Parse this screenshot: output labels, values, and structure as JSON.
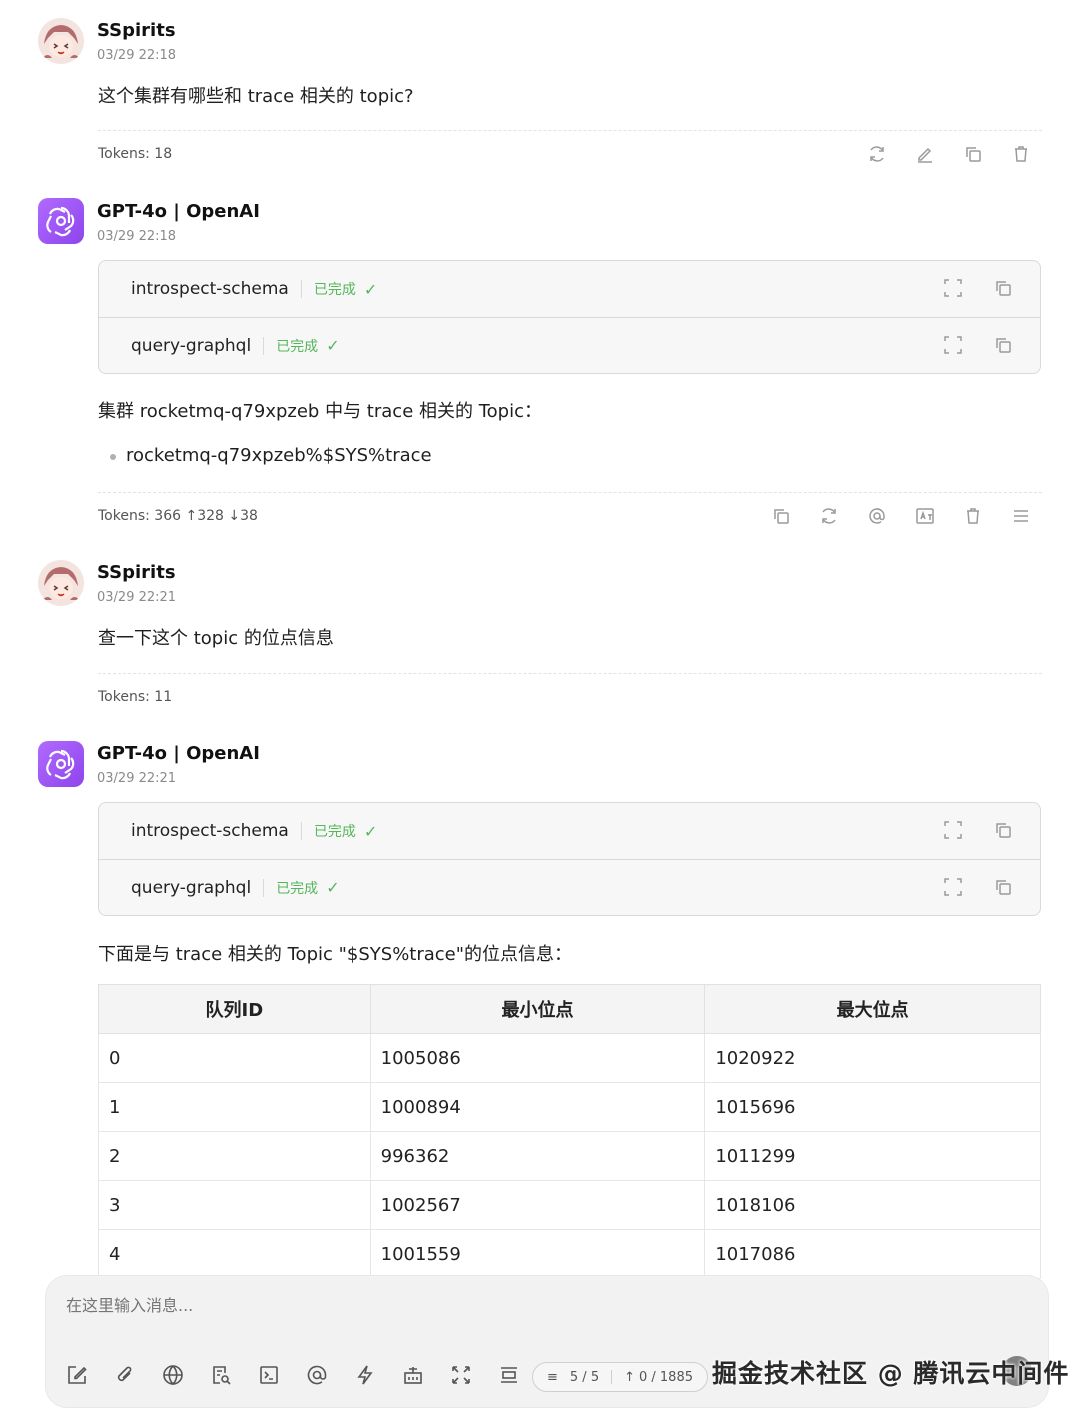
{
  "messages": [
    {
      "role": "user",
      "name": "SSpirits",
      "time": "03/29 22:18",
      "text": "这个集群有哪些和 trace 相关的 topic?",
      "tokens": "Tokens: 18"
    },
    {
      "role": "assistant",
      "name": "GPT-4o | OpenAI",
      "time": "03/29 22:18",
      "tools": [
        {
          "name": "introspect-schema",
          "status": "已完成"
        },
        {
          "name": "query-graphql",
          "status": "已完成"
        }
      ],
      "text": "集群 rocketmq-q79xpzeb 中与 trace 相关的 Topic：",
      "bullets": [
        "rocketmq-q79xpzeb%$SYS%trace"
      ],
      "tokens": "Tokens: 366 ↑328 ↓38"
    },
    {
      "role": "user",
      "name": "SSpirits",
      "time": "03/29 22:21",
      "text": "查一下这个 topic 的位点信息",
      "tokens": "Tokens: 11"
    },
    {
      "role": "assistant",
      "name": "GPT-4o | OpenAI",
      "time": "03/29 22:21",
      "tools": [
        {
          "name": "introspect-schema",
          "status": "已完成"
        },
        {
          "name": "query-graphql",
          "status": "已完成"
        }
      ],
      "text": "下面是与 trace 相关的 Topic \"$SYS%trace\"的位点信息：",
      "table": {
        "headers": [
          "队列ID",
          "最小位点",
          "最大位点"
        ],
        "rows": [
          [
            "0",
            "1005086",
            "1020922"
          ],
          [
            "1",
            "1000894",
            "1015696"
          ],
          [
            "2",
            "996362",
            "1011299"
          ],
          [
            "3",
            "1002567",
            "1018106"
          ],
          [
            "4",
            "1001559",
            "1017086"
          ]
        ]
      }
    }
  ],
  "composer": {
    "placeholder": "在这里输入消息...",
    "page_counter": "5 / 5",
    "token_counter": "0 / 1885"
  },
  "watermark": "掘金技术社区 @ 腾讯云中间件",
  "colors": {
    "status_green": "#55b75a",
    "gpt_avatar": "#a259f7"
  }
}
